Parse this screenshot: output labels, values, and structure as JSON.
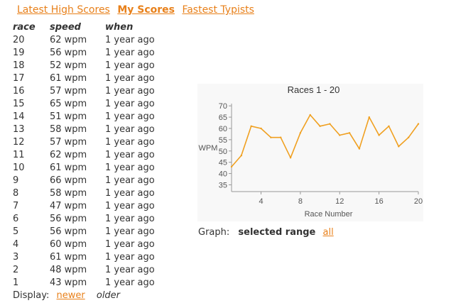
{
  "nav": {
    "latest": "Latest High Scores",
    "mine": "My Scores",
    "fastest": "Fastest Typists"
  },
  "table": {
    "headers": [
      "race",
      "speed",
      "when"
    ],
    "rows": [
      [
        "20",
        "62 wpm",
        "1 year ago"
      ],
      [
        "19",
        "56 wpm",
        "1 year ago"
      ],
      [
        "18",
        "52 wpm",
        "1 year ago"
      ],
      [
        "17",
        "61 wpm",
        "1 year ago"
      ],
      [
        "16",
        "57 wpm",
        "1 year ago"
      ],
      [
        "15",
        "65 wpm",
        "1 year ago"
      ],
      [
        "14",
        "51 wpm",
        "1 year ago"
      ],
      [
        "13",
        "58 wpm",
        "1 year ago"
      ],
      [
        "12",
        "57 wpm",
        "1 year ago"
      ],
      [
        "11",
        "62 wpm",
        "1 year ago"
      ],
      [
        "10",
        "61 wpm",
        "1 year ago"
      ],
      [
        "9",
        "66 wpm",
        "1 year ago"
      ],
      [
        "8",
        "58 wpm",
        "1 year ago"
      ],
      [
        "7",
        "47 wpm",
        "1 year ago"
      ],
      [
        "6",
        "56 wpm",
        "1 year ago"
      ],
      [
        "5",
        "56 wpm",
        "1 year ago"
      ],
      [
        "4",
        "60 wpm",
        "1 year ago"
      ],
      [
        "3",
        "61 wpm",
        "1 year ago"
      ],
      [
        "2",
        "48 wpm",
        "1 year ago"
      ],
      [
        "1",
        "43 wpm",
        "1 year ago"
      ]
    ]
  },
  "display": {
    "label": "Display:",
    "newer": "newer",
    "older": "older"
  },
  "graph": {
    "label": "Graph:",
    "selected": "selected range",
    "all": "all"
  },
  "colors": {
    "accent": "#e8801a",
    "line": "#f0a020",
    "text": "#333333"
  },
  "chart_data": {
    "type": "line",
    "title": "Races 1 - 20",
    "xlabel": "Race Number",
    "ylabel": "WPM",
    "x": [
      1,
      2,
      3,
      4,
      5,
      6,
      7,
      8,
      9,
      10,
      11,
      12,
      13,
      14,
      15,
      16,
      17,
      18,
      19,
      20
    ],
    "values": [
      43,
      48,
      61,
      60,
      56,
      56,
      47,
      58,
      66,
      61,
      62,
      57,
      58,
      51,
      65,
      57,
      61,
      52,
      56,
      62
    ],
    "xticks": [
      "4",
      "8",
      "12",
      "16",
      "20"
    ],
    "yticks": [
      "35",
      "40",
      "45",
      "50",
      "55",
      "60",
      "65",
      "70"
    ],
    "xlim": [
      1,
      20
    ],
    "ylim": [
      32,
      71
    ],
    "grid": false
  }
}
